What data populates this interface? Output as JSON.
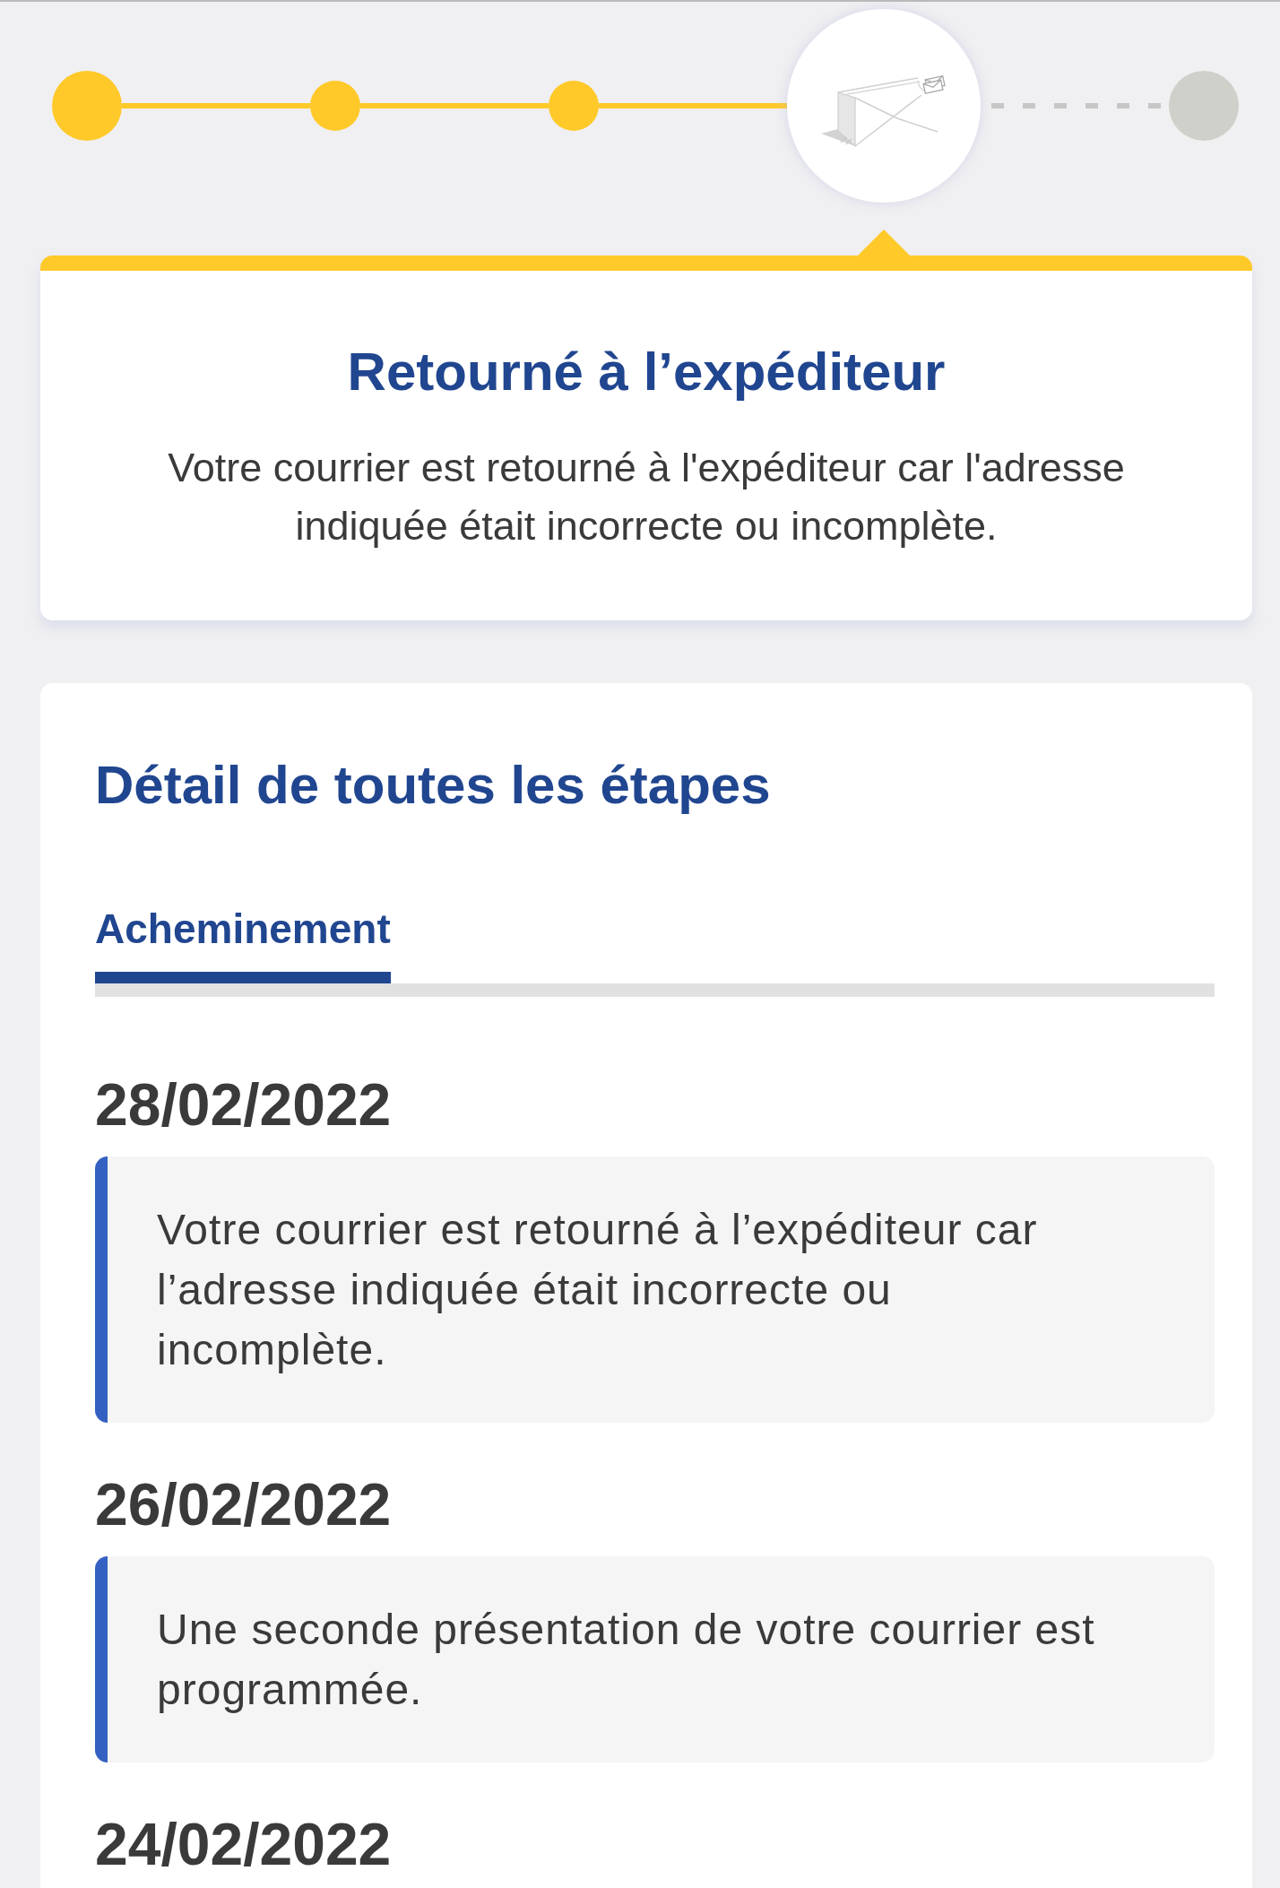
{
  "tracker": {
    "steps": [
      {
        "reached": true,
        "current": false
      },
      {
        "reached": true,
        "current": false
      },
      {
        "reached": true,
        "current": false
      },
      {
        "reached": true,
        "current": true
      },
      {
        "reached": false,
        "current": false
      }
    ]
  },
  "status_card": {
    "title": "Retourné à l’expéditeur",
    "description": "Votre courrier est retourné à l'expéditeur car l'adresse indiquée était incorrecte ou incomplète."
  },
  "details": {
    "title": "Détail de toutes les étapes",
    "tabs": [
      {
        "label": "Acheminement",
        "selected": true
      }
    ],
    "events": [
      {
        "date": "28/02/2022",
        "text": "Votre courrier est retourné à l’expéditeur car l’adresse indiquée était incorrecte ou incomplète."
      },
      {
        "date": "26/02/2022",
        "text": "Une seconde présentation de votre courrier est programmée."
      },
      {
        "date": "24/02/2022"
      }
    ]
  }
}
